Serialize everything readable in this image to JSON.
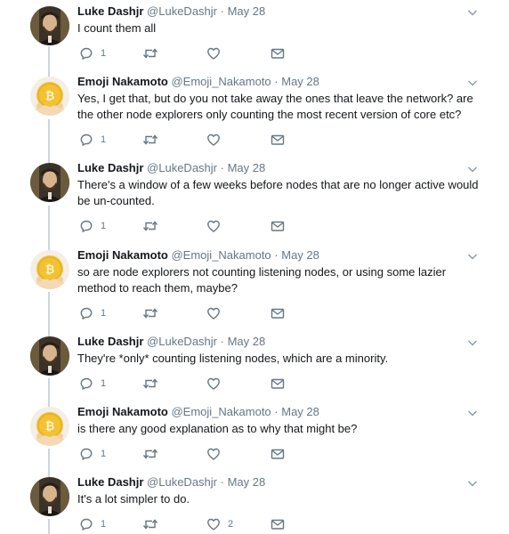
{
  "ui": {
    "colors": {
      "text": "#14171a",
      "muted": "#657786",
      "thread_line": "#ccd6dd"
    },
    "icons": {
      "reply": "reply-icon",
      "retweet": "retweet-icon",
      "like": "heart-icon",
      "dm": "envelope-icon",
      "menu": "chevron-down-icon"
    }
  },
  "tweets": [
    {
      "name": "Luke Dashjr",
      "handle": "@LukeDashjr",
      "date": "May 28",
      "text": "I count them all",
      "replies": "1",
      "likes": ""
    },
    {
      "name": "Emoji Nakamoto",
      "handle": "@Emoji_Nakamoto",
      "date": "May 28",
      "text": "Yes, I get that, but do you not take away the ones that leave the network? are the other node explorers only counting the most recent version of core etc?",
      "replies": "1",
      "likes": ""
    },
    {
      "name": "Luke Dashjr",
      "handle": "@LukeDashjr",
      "date": "May 28",
      "text": "There's a window of a few weeks before nodes that are no longer active would be un-counted.",
      "replies": "1",
      "likes": ""
    },
    {
      "name": "Emoji Nakamoto",
      "handle": "@Emoji_Nakamoto",
      "date": "May 28",
      "text": "so are node explorers not counting listening nodes, or using some lazier method to reach them, maybe?",
      "replies": "1",
      "likes": ""
    },
    {
      "name": "Luke Dashjr",
      "handle": "@LukeDashjr",
      "date": "May 28",
      "text": "They're *only* counting listening nodes, which are a minority.",
      "replies": "1",
      "likes": ""
    },
    {
      "name": "Emoji Nakamoto",
      "handle": "@Emoji_Nakamoto",
      "date": "May 28",
      "text": "is there any good explanation as to why that might be?",
      "replies": "1",
      "likes": ""
    },
    {
      "name": "Luke Dashjr",
      "handle": "@LukeDashjr",
      "date": "May 28",
      "text": "It's a lot simpler to do.",
      "replies": "1",
      "likes": "2"
    }
  ]
}
